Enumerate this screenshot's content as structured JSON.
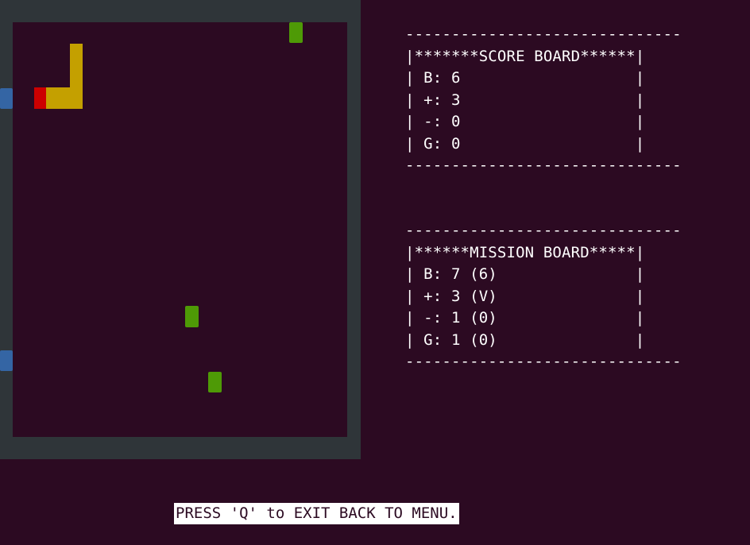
{
  "game": {
    "colors": {
      "background": "#2c0a22",
      "wall": "#2f3539",
      "food_green": "#4e9a06",
      "item_blue": "#3465a4",
      "snake_body": "#c4a000",
      "snake_head": "#cc0000"
    }
  },
  "score_board": {
    "border": "------------------------------",
    "title": "|*******SCORE BOARD******|",
    "rows": [
      "| B: 6                   |",
      "| +: 3                   |",
      "| -: 0                   |",
      "| G: 0                   |"
    ]
  },
  "mission_board": {
    "border": "------------------------------",
    "title": "|******MISSION BOARD*****|",
    "rows": [
      "| B: 7 (6)               |",
      "| +: 3 (V)               |",
      "| -: 1 (0)               |",
      "| G: 1 (0)               |"
    ]
  },
  "footer": {
    "text": "PRESS 'Q' to EXIT BACK TO MENU."
  }
}
